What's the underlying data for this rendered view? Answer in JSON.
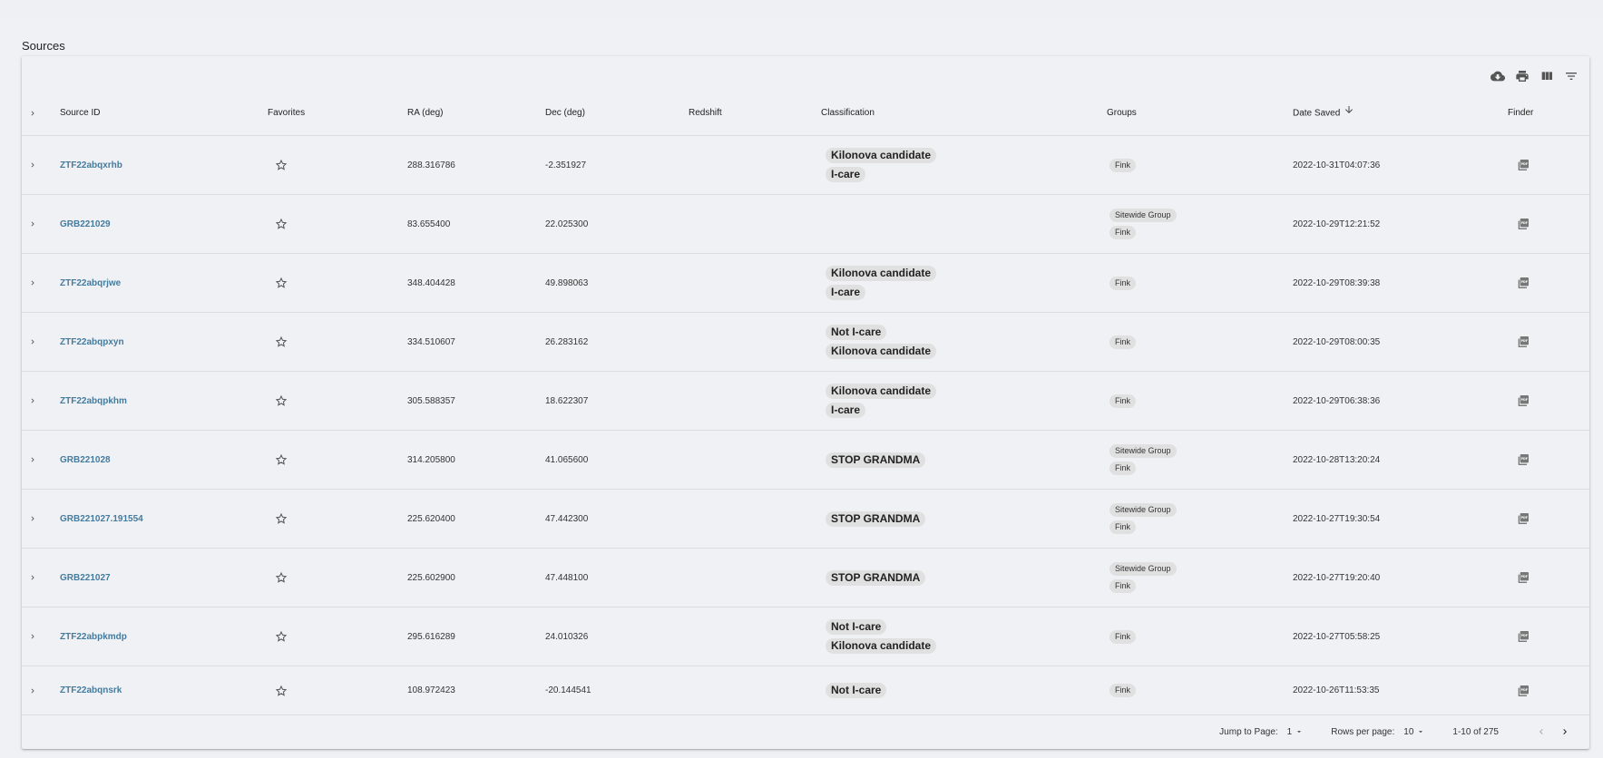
{
  "page": {
    "title": "Sources"
  },
  "toolbar": {
    "icons": [
      "cloud-download-icon",
      "print-icon",
      "view-columns-icon",
      "filter-icon"
    ]
  },
  "columns": {
    "source_id": "Source ID",
    "favorites": "Favorites",
    "ra": "RA (deg)",
    "dec": "Dec (deg)",
    "redshift": "Redshift",
    "classification": "Classification",
    "groups": "Groups",
    "date_saved": "Date Saved",
    "finder": "Finder"
  },
  "rows": [
    {
      "source_id": "ZTF22abqxrhb",
      "ra": "288.316786",
      "dec": "-2.351927",
      "redshift": "",
      "classifications": [
        "Kilonova candidate",
        "I-care"
      ],
      "groups": [
        "Fink"
      ],
      "date_saved": "2022-10-31T04:07:36"
    },
    {
      "source_id": "GRB221029",
      "ra": "83.655400",
      "dec": "22.025300",
      "redshift": "",
      "classifications": [],
      "groups": [
        "Sitewide Group",
        "Fink"
      ],
      "date_saved": "2022-10-29T12:21:52"
    },
    {
      "source_id": "ZTF22abqrjwe",
      "ra": "348.404428",
      "dec": "49.898063",
      "redshift": "",
      "classifications": [
        "Kilonova candidate",
        "I-care"
      ],
      "groups": [
        "Fink"
      ],
      "date_saved": "2022-10-29T08:39:38"
    },
    {
      "source_id": "ZTF22abqpxyn",
      "ra": "334.510607",
      "dec": "26.283162",
      "redshift": "",
      "classifications": [
        "Not I-care",
        "Kilonova candidate"
      ],
      "groups": [
        "Fink"
      ],
      "date_saved": "2022-10-29T08:00:35"
    },
    {
      "source_id": "ZTF22abqpkhm",
      "ra": "305.588357",
      "dec": "18.622307",
      "redshift": "",
      "classifications": [
        "Kilonova candidate",
        "I-care"
      ],
      "groups": [
        "Fink"
      ],
      "date_saved": "2022-10-29T06:38:36"
    },
    {
      "source_id": "GRB221028",
      "ra": "314.205800",
      "dec": "41.065600",
      "redshift": "",
      "classifications": [
        "STOP GRANDMA"
      ],
      "groups": [
        "Sitewide Group",
        "Fink"
      ],
      "date_saved": "2022-10-28T13:20:24"
    },
    {
      "source_id": "GRB221027.191554",
      "ra": "225.620400",
      "dec": "47.442300",
      "redshift": "",
      "classifications": [
        "STOP GRANDMA"
      ],
      "groups": [
        "Sitewide Group",
        "Fink"
      ],
      "date_saved": "2022-10-27T19:30:54"
    },
    {
      "source_id": "GRB221027",
      "ra": "225.602900",
      "dec": "47.448100",
      "redshift": "",
      "classifications": [
        "STOP GRANDMA"
      ],
      "groups": [
        "Sitewide Group",
        "Fink"
      ],
      "date_saved": "2022-10-27T19:20:40"
    },
    {
      "source_id": "ZTF22abpkmdp",
      "ra": "295.616289",
      "dec": "24.010326",
      "redshift": "",
      "classifications": [
        "Not I-care",
        "Kilonova candidate"
      ],
      "groups": [
        "Fink"
      ],
      "date_saved": "2022-10-27T05:58:25"
    },
    {
      "source_id": "ZTF22abqnsrk",
      "ra": "108.972423",
      "dec": "-20.144541",
      "redshift": "",
      "classifications": [
        "Not I-care"
      ],
      "groups": [
        "Fink"
      ],
      "date_saved": "2022-10-26T11:53:35"
    }
  ],
  "footer": {
    "jump_label": "Jump to Page:",
    "jump_value": "1",
    "rows_label": "Rows per page:",
    "rows_value": "10",
    "range": "1-10 of 275"
  },
  "colors": {
    "link": "#457b9d",
    "chip_bg": "#e0e0e0",
    "background": "#f0f1f5"
  }
}
